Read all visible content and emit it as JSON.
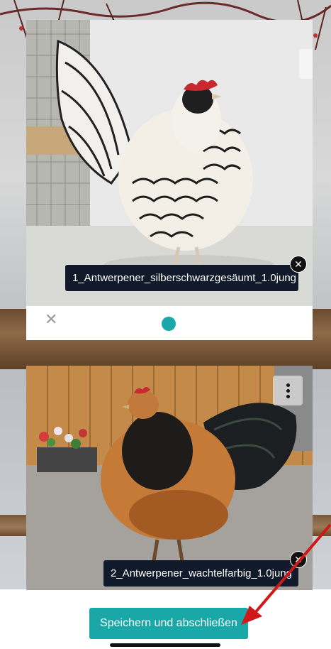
{
  "cards": [
    {
      "filename": "1_Antwerpener_silberschwarzgesäumt_1.0jung",
      "photo_subject": "silver black-laced bantam rooster",
      "menu_icon": "kebab-icon",
      "remove_icon": "close-icon",
      "footer": {
        "close_glyph": "✕",
        "status_icon": "dot-icon"
      }
    },
    {
      "filename": "2_Antwerpener_wachtelfarbig_1.0jung",
      "photo_subject": "quail-colored bantam rooster",
      "menu_icon": "kebab-icon",
      "remove_icon": "close-icon"
    }
  ],
  "save_button": {
    "label": "Speichern und abschließen"
  },
  "colors": {
    "accent": "#1aa7a8",
    "label_bg": "#111a2a",
    "arrow": "#d01818"
  }
}
